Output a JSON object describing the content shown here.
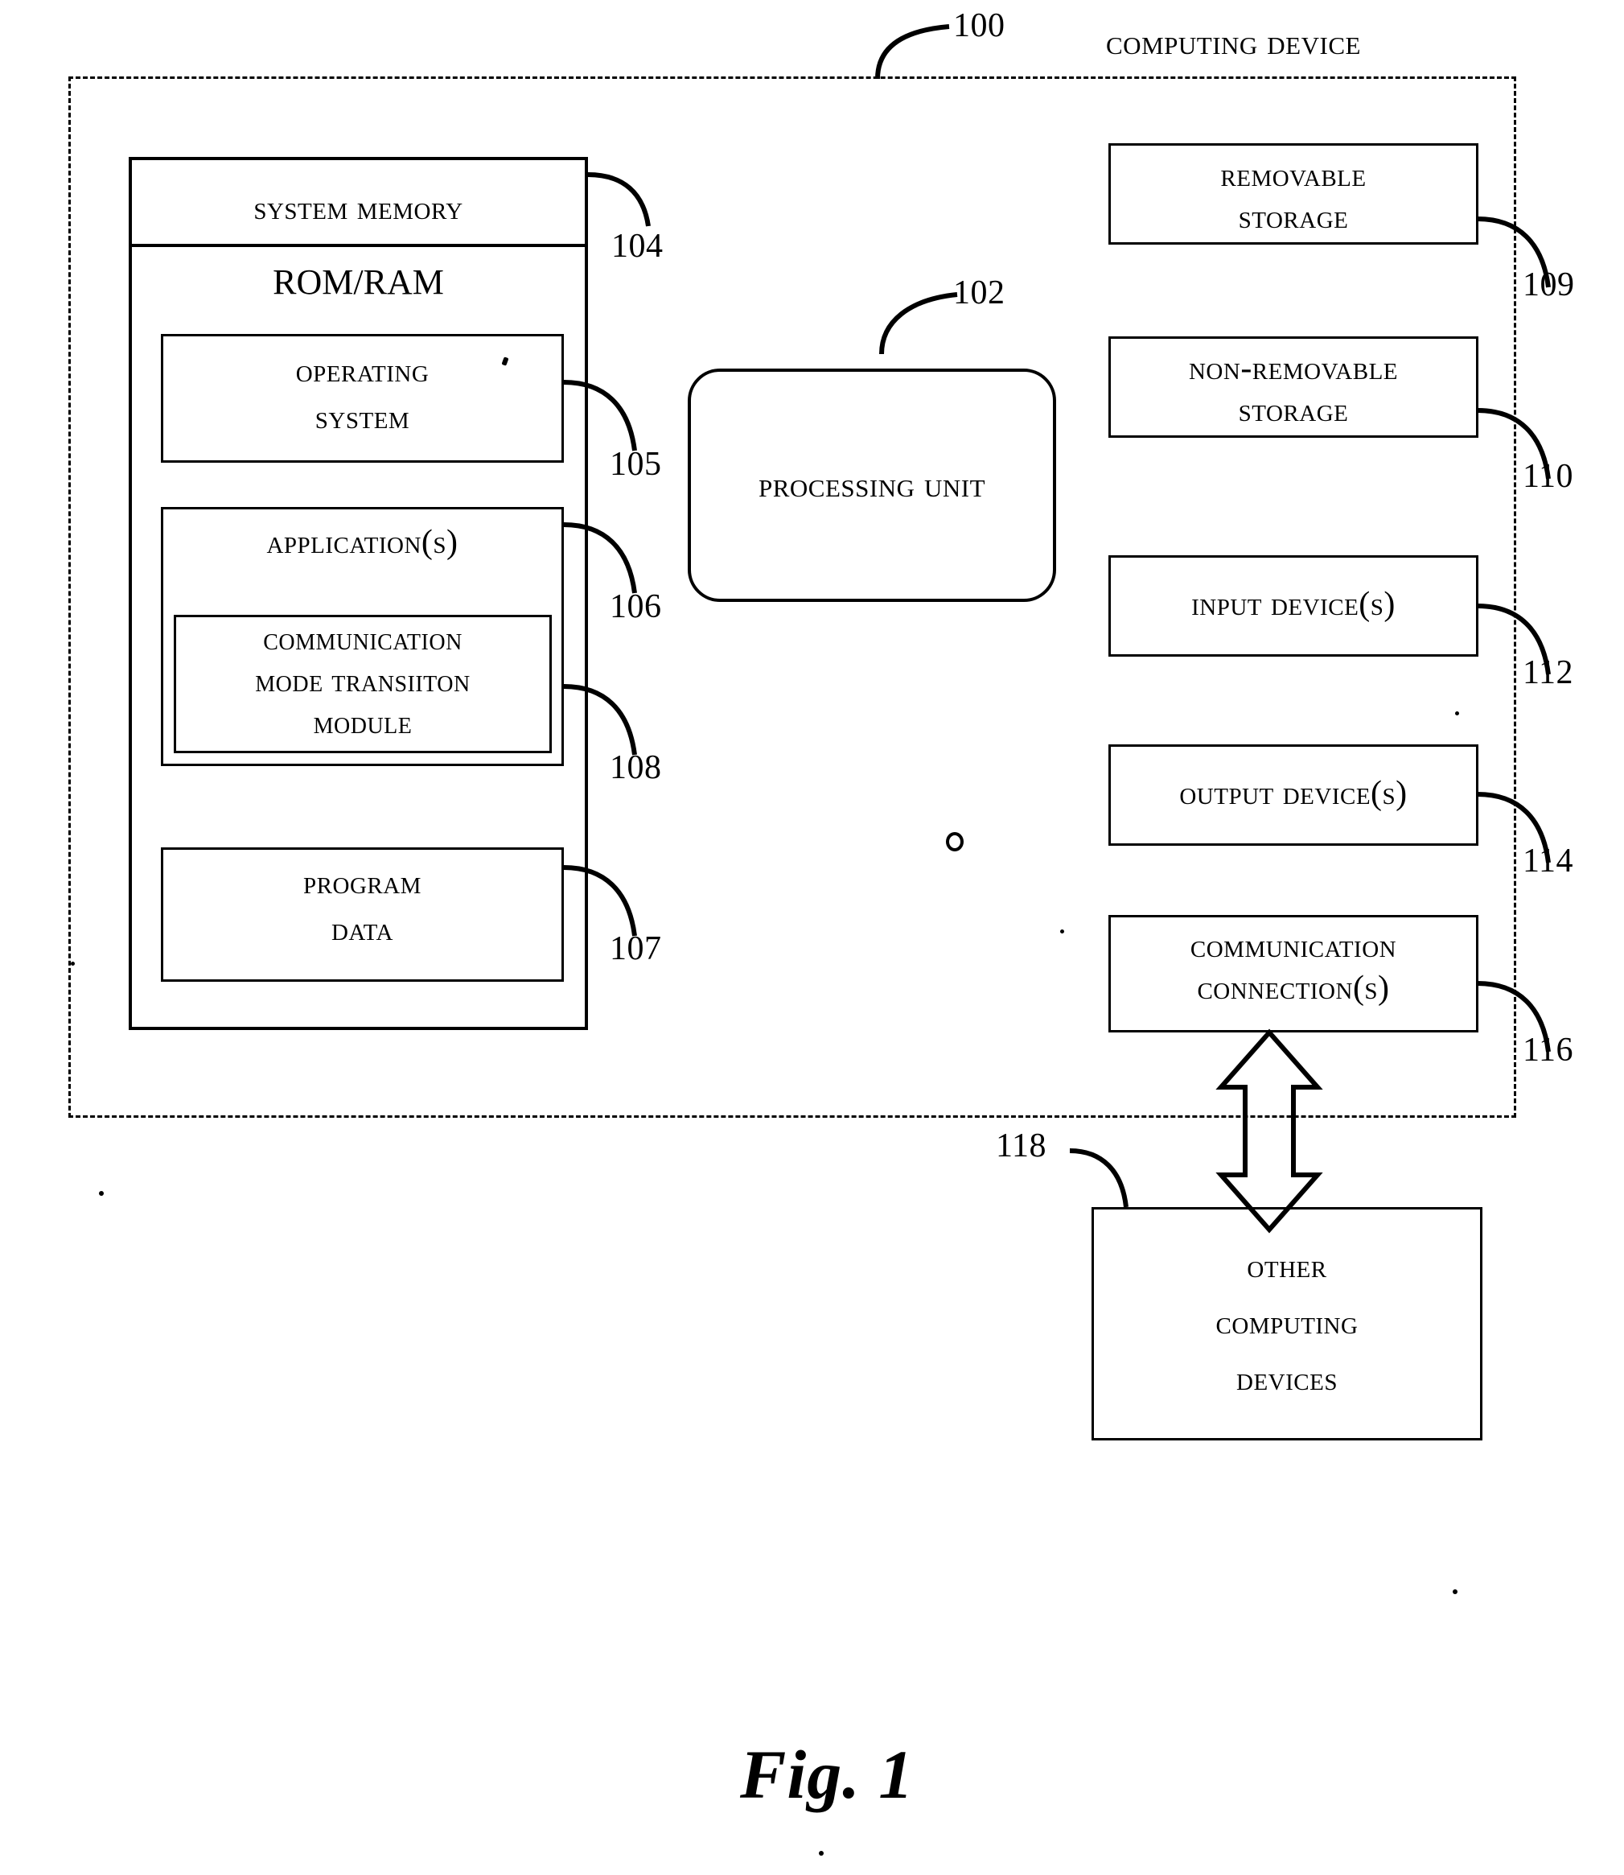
{
  "figure": {
    "caption": "Fig. 1",
    "title": "COMPUTING DEVICE",
    "title_ref": "100"
  },
  "boxes": {
    "system_memory": {
      "label": "SYSTEM MEMORY",
      "ref": "104",
      "sub_label": "ROM/RAM"
    },
    "operating_system": {
      "line1": "OPERATING",
      "line2": "SYSTEM",
      "ref": "105"
    },
    "applications": {
      "label": "APPLICATION(S)",
      "ref": "106"
    },
    "comm_mode_module": {
      "line1": "COMMUNICATION",
      "line2": "MODE TRANSIITON",
      "line3": "MODULE",
      "ref": "108"
    },
    "program_data": {
      "line1": "PROGRAM",
      "line2": "DATA",
      "ref": "107"
    },
    "processing_unit": {
      "label": "PROCESSING UNIT",
      "ref": "102"
    },
    "removable_storage": {
      "line1": "REMOVABLE",
      "line2": "STORAGE",
      "ref": "109"
    },
    "non_removable_storage": {
      "line1": "NON-REMOVABLE",
      "line2": "STORAGE",
      "ref": "110"
    },
    "input_devices": {
      "label": "INPUT DEVICE(S)",
      "ref": "112"
    },
    "output_devices": {
      "label": "OUTPUT DEVICE(S)",
      "ref": "114"
    },
    "communication_connections": {
      "line1": "COMMUNICATION",
      "line2": "CONNECTION(S)",
      "ref": "116"
    },
    "other_computing_devices": {
      "line1": "OTHER",
      "line2": "COMPUTING",
      "line3": "DEVICES",
      "ref": "118"
    }
  },
  "colors": {
    "ink": "#000000",
    "paper": "#ffffff"
  }
}
